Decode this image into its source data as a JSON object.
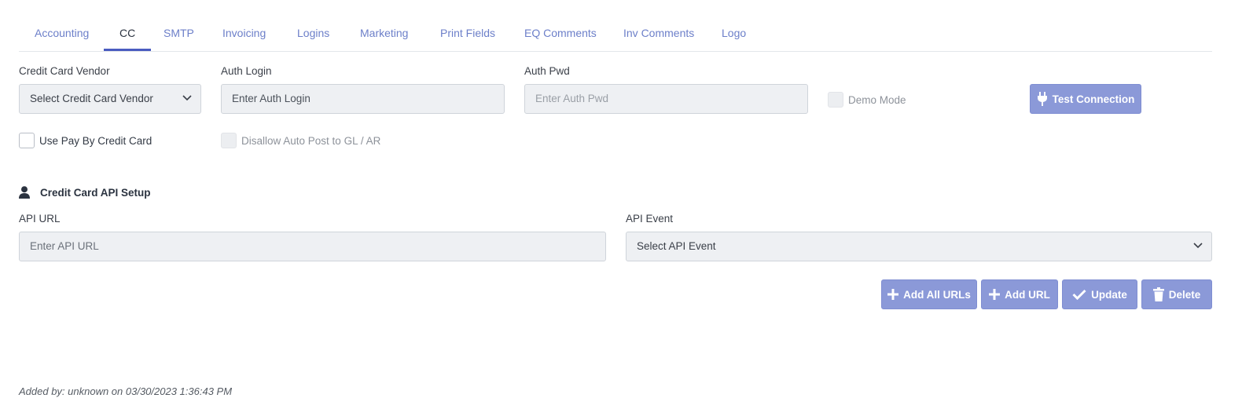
{
  "tabs": [
    {
      "label": "Accounting"
    },
    {
      "label": "CC"
    },
    {
      "label": "SMTP"
    },
    {
      "label": "Invoicing"
    },
    {
      "label": "Logins"
    },
    {
      "label": "Marketing"
    },
    {
      "label": "Print Fields"
    },
    {
      "label": "EQ Comments"
    },
    {
      "label": "Inv Comments"
    },
    {
      "label": "Logo"
    }
  ],
  "active_tab": "CC",
  "form": {
    "vendor_label": "Credit Card Vendor",
    "vendor_value": "Select Credit Card Vendor",
    "auth_login_label": "Auth Login",
    "auth_login_placeholder": "Enter Auth Login",
    "auth_pwd_label": "Auth Pwd",
    "auth_pwd_placeholder": "Enter Auth Pwd",
    "demo_mode_label": "Demo Mode",
    "test_connection_label": "Test Connection",
    "use_pay_label": "Use Pay By Credit Card",
    "disallow_label": "Disallow Auto Post to GL / AR"
  },
  "api_setup": {
    "title": "Credit Card API Setup",
    "url_label": "API URL",
    "url_placeholder": "Enter API URL",
    "event_label": "API Event",
    "event_value": "Select API Event"
  },
  "actions": {
    "add_all_urls": "Add All URLs",
    "add_url": "Add URL",
    "update": "Update",
    "delete": "Delete"
  },
  "footer": {
    "added_by": "Added by: unknown on 03/30/2023 1:36:43 PM"
  },
  "colors": {
    "accent": "#8b99d8",
    "tab_link": "#6c7fc9",
    "active_underline": "#4a5cc0"
  }
}
